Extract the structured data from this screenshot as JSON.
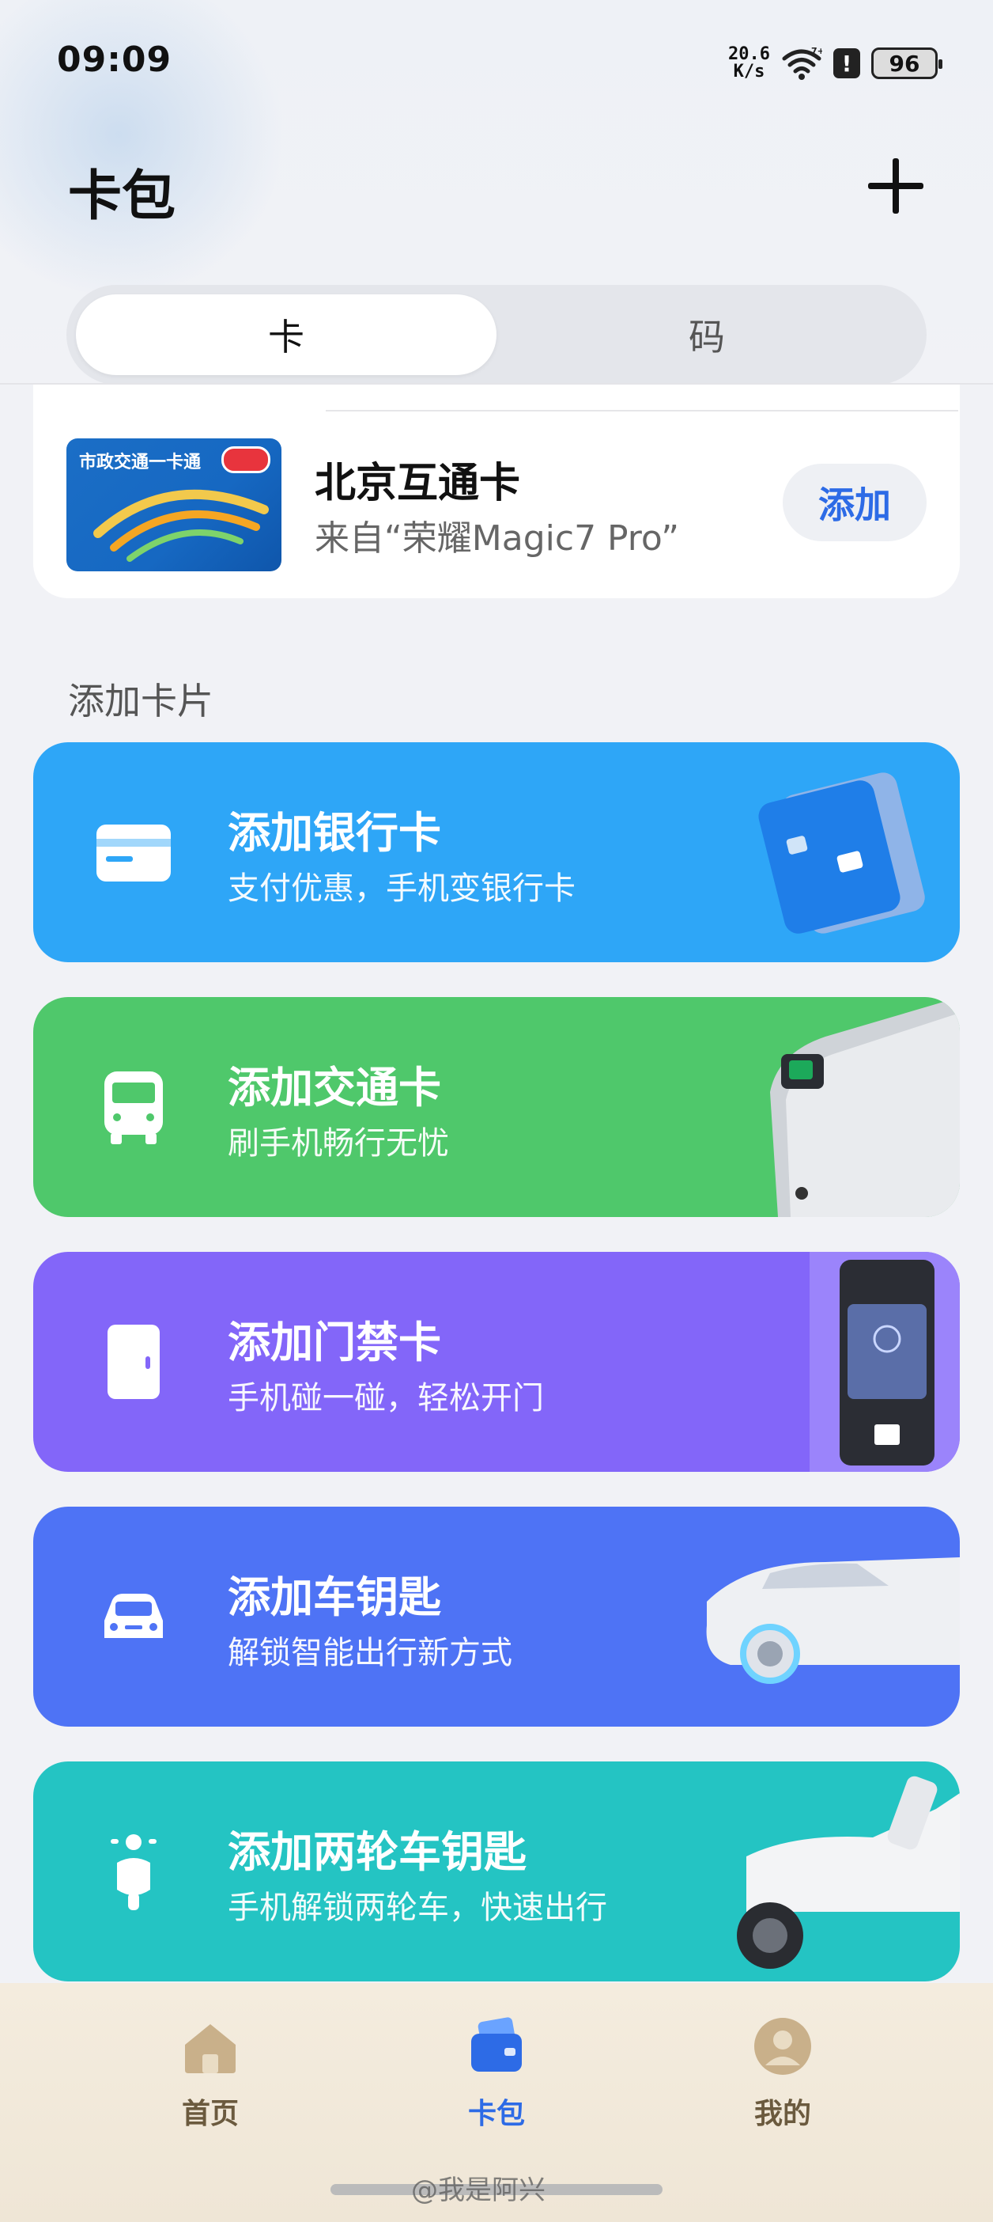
{
  "status_bar": {
    "time": "09:09",
    "net_speed_value": "20.6",
    "net_speed_unit": "K/s",
    "wifi_label": "7+",
    "battery": "96"
  },
  "header": {
    "title": "卡包"
  },
  "tabs": [
    {
      "label": "卡",
      "active": true
    },
    {
      "label": "码",
      "active": false
    }
  ],
  "existing_card": {
    "image_text": "市政交通一卡通",
    "name": "北京互通卡",
    "source": "来自“荣耀Magic7 Pro”",
    "action_label": "添加"
  },
  "section_title": "添加卡片",
  "add_cards": [
    {
      "title": "添加银行卡",
      "subtitle": "支付优惠，手机变银行卡",
      "color": "#2ea6f7",
      "icon": "bank-card-icon"
    },
    {
      "title": "添加交通卡",
      "subtitle": "刷手机畅行无忧",
      "color": "#4fc86b",
      "icon": "bus-icon"
    },
    {
      "title": "添加门禁卡",
      "subtitle": "手机碰一碰，轻松开门",
      "color": "#8366f9",
      "icon": "door-icon"
    },
    {
      "title": "添加车钥匙",
      "subtitle": "解锁智能出行新方式",
      "color": "#4e73f5",
      "icon": "car-icon"
    },
    {
      "title": "添加两轮车钥匙",
      "subtitle": "手机解锁两轮车，快速出行",
      "color": "#24c4c3",
      "icon": "scooter-icon"
    }
  ],
  "bottom_nav": [
    {
      "label": "首页",
      "icon": "home-icon",
      "active": false
    },
    {
      "label": "卡包",
      "icon": "wallet-icon",
      "active": true
    },
    {
      "label": "我的",
      "icon": "profile-icon",
      "active": false
    }
  ],
  "watermark": "@我是阿兴",
  "colors": {
    "accent": "#2d6be6",
    "background": "#f1f2f6"
  }
}
